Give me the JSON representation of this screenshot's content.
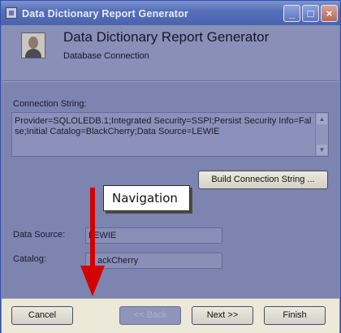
{
  "window": {
    "title": "Data Dictionary Report Generator",
    "controls": {
      "minimize": "_",
      "maximize": "□",
      "close": "×"
    }
  },
  "header": {
    "title": "Data Dictionary Report Generator",
    "subtitle": "Database Connection",
    "avatar_icon": "user-avatar"
  },
  "connection": {
    "label": "Connection String:",
    "value": "Provider=SQLOLEDB.1;Integrated Security=SSPI;Persist Security Info=False;Initial Catalog=BlackCherry;Data Source=LEWIE",
    "build_button": "Build Connection String ..."
  },
  "fields": {
    "data_source_label": "Data Source:",
    "data_source_value": "LEWIE",
    "catalog_label": "Catalog:",
    "catalog_value": "ackCherry"
  },
  "annotation": {
    "callout_text": "Navigation",
    "arrow_color": "#d40000"
  },
  "footer": {
    "cancel": "Cancel",
    "back": "<< Back",
    "next": "Next >>",
    "finish": "Finish"
  }
}
